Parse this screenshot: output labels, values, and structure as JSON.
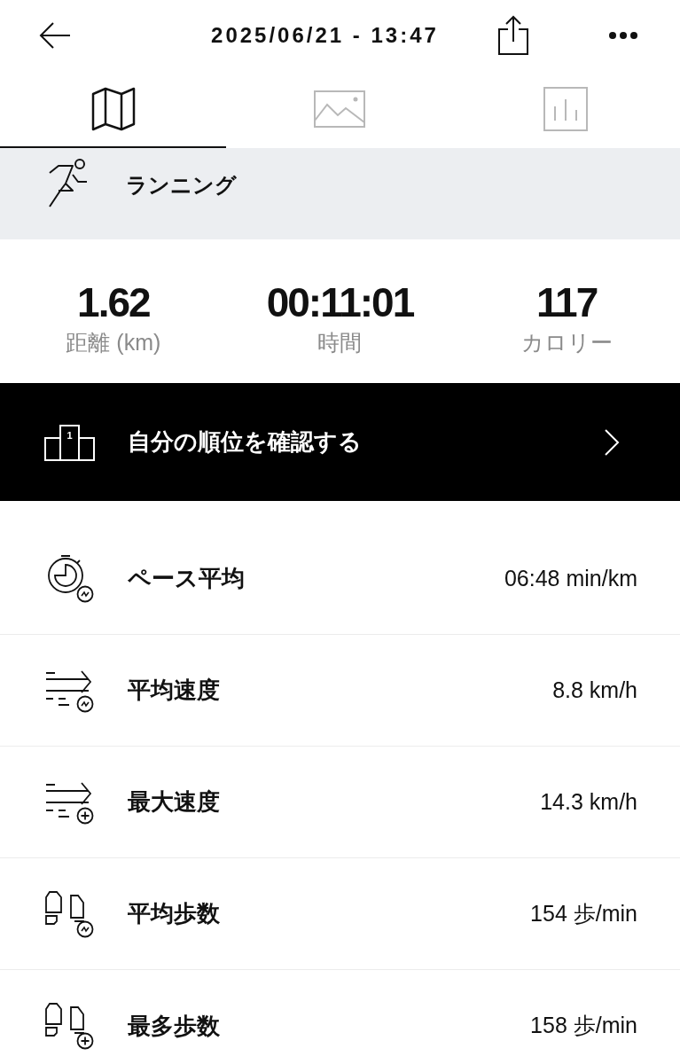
{
  "header": {
    "title": "2025/06/21 - 13:47"
  },
  "tabs": [
    {
      "kind": "map",
      "selected": true
    },
    {
      "kind": "photo",
      "selected": false
    },
    {
      "kind": "chart",
      "selected": false
    }
  ],
  "activity": {
    "name": "ランニング"
  },
  "stats": [
    {
      "value": "1.62",
      "label": "距離 (km)"
    },
    {
      "value": "00:11:01",
      "label": "時間"
    },
    {
      "value": "117",
      "label": "カロリー"
    }
  ],
  "ranking": {
    "label": "自分の順位を確認する",
    "podium_rank": "1"
  },
  "metrics": [
    {
      "kind": "stopwatch-average",
      "label": "ペース平均",
      "value": "06:48 min/km"
    },
    {
      "kind": "speed-average",
      "label": "平均速度",
      "value": "8.8 km/h"
    },
    {
      "kind": "speed-max",
      "label": "最大速度",
      "value": "14.3 km/h"
    },
    {
      "kind": "steps-average",
      "label": "平均歩数",
      "value": "154 歩/min"
    },
    {
      "kind": "steps-max",
      "label": "最多歩数",
      "value": "158 歩/min"
    }
  ]
}
